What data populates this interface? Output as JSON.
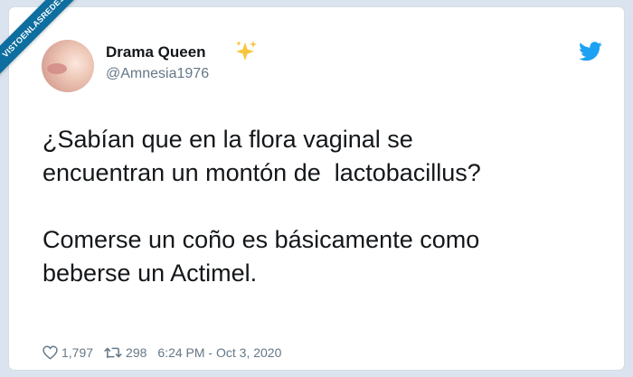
{
  "watermark": {
    "text": "VISTOENLASREDES"
  },
  "tweet": {
    "display_name": "Drama Queen",
    "name_emoji": "sparkles-icon",
    "handle": "@Amnesia1976",
    "paragraphs": [
      "¿Sabían que en la flora vaginal se\nencuentran un montón de  lactobacillus?",
      "Comerse un coño es básicamente como\nbeberse un Actimel."
    ],
    "likes": "1,797",
    "retweets": "298",
    "timestamp": "6:24 PM - Oct 3, 2020"
  },
  "icons": {
    "brand": "twitter-bird-icon",
    "like": "heart-icon",
    "retweet": "retweet-icon"
  },
  "colors": {
    "page_background": "#dbe4ee",
    "card_background": "#ffffff",
    "text_primary": "#14171a",
    "text_secondary": "#657786",
    "twitter_blue": "#1da1f2",
    "ribbon": "#0d6e9f"
  }
}
